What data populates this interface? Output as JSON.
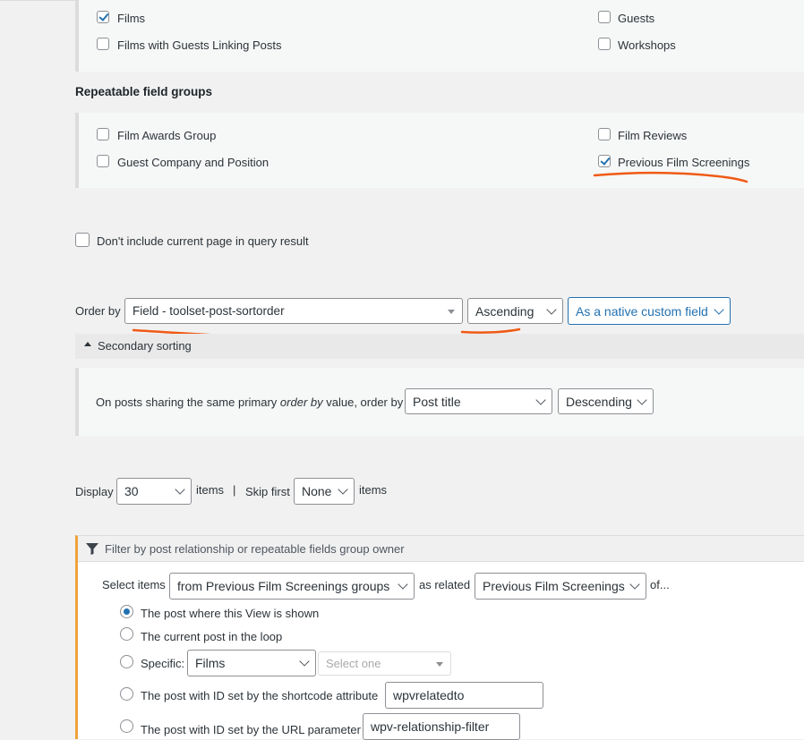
{
  "post_types": {
    "left": [
      {
        "label": "Films",
        "checked": true
      },
      {
        "label": "Films with Guests Linking Posts",
        "checked": false
      }
    ],
    "right": [
      {
        "label": "Guests",
        "checked": false
      },
      {
        "label": "Workshops",
        "checked": false
      }
    ]
  },
  "rfg": {
    "heading": "Repeatable field groups",
    "left": [
      {
        "label": "Film Awards Group",
        "checked": false
      },
      {
        "label": "Guest Company and Position",
        "checked": false
      }
    ],
    "right": [
      {
        "label": "Film Reviews",
        "checked": false
      },
      {
        "label": "Previous Film Screenings",
        "checked": true
      }
    ]
  },
  "exclude_current": {
    "label": "Don't include current page in query result",
    "checked": false
  },
  "order": {
    "label": "Order by",
    "field": "Field - toolset-post-sortorder",
    "direction": "Ascending",
    "as": "As a native custom field"
  },
  "secondary": {
    "toggle_label": "Secondary sorting",
    "text_pre": "On posts sharing the same primary ",
    "text_em": "order by",
    "text_post": " value, order by",
    "field": "Post title",
    "direction": "Descending"
  },
  "pagination": {
    "display_label": "Display",
    "display_value": "30",
    "items_label": "items",
    "separator": "|",
    "skip_label": "Skip first",
    "skip_value": "None",
    "items_label2": "items"
  },
  "relationship": {
    "header": "Filter by post relationship or repeatable fields group owner",
    "select_label": "Select items",
    "from_value": "from Previous Film Screenings groups",
    "as_related": "as related",
    "related_value": "Previous Film Screenings",
    "of": "of...",
    "options": {
      "shown": "The post where this View is shown",
      "loop": "The current post in the loop",
      "specific": "Specific:",
      "specific_type": "Films",
      "specific_placeholder": "Select one",
      "shortcode": "The post with ID set by the shortcode attribute",
      "shortcode_value": "wpvrelatedto",
      "url": "The post with ID set by the URL parameter",
      "url_value": "wpv-relationship-filter"
    }
  },
  "colors": {
    "accent": "#2271b1",
    "annotation": "#f05a14",
    "filter_border": "#f0a23c"
  }
}
